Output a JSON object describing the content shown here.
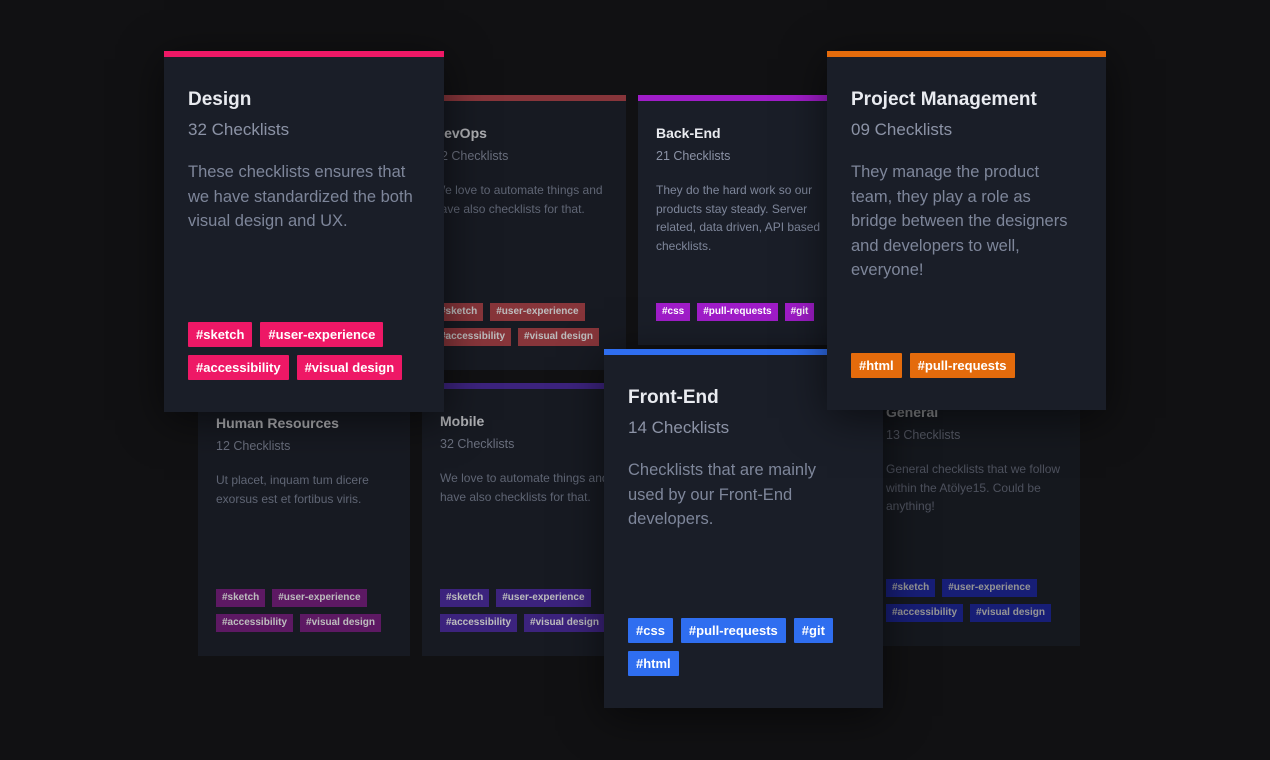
{
  "cards": {
    "devops": {
      "title": "DevOps",
      "count": "32 Checklists",
      "desc": "We love to automate things and have also checklists for that.",
      "tags": [
        "#sketch",
        "#user-experience",
        "#accessibility",
        "#visual design"
      ],
      "accent": "#b54349"
    },
    "backend": {
      "title": "Back-End",
      "count": "21 Checklists",
      "desc": "They do the hard work so our products stay steady. Server related, data driven, API based checklists.",
      "tags": [
        "#css",
        "#pull-requests",
        "#git"
      ],
      "accent": "#a01dc9"
    },
    "hr": {
      "title": "Human Resources",
      "count": "12 Checklists",
      "desc": "Ut placet, inquam tum dicere exorsus est et fortibus viris.",
      "tags": [
        "#sketch",
        "#user-experience",
        "#accessibility",
        "#visual design"
      ],
      "accent": "#7b1d82"
    },
    "mobile": {
      "title": "Mobile",
      "count": "32 Checklists",
      "desc": "We love to automate things and have also checklists for that.",
      "tags": [
        "#sketch",
        "#user-experience",
        "#accessibility",
        "#visual design"
      ],
      "accent": "#4d2aa7"
    },
    "general": {
      "title": "General",
      "count": "13 Checklists",
      "desc": "General checklists that we follow within the Atölye15. Could be anything!",
      "tags": [
        "#sketch",
        "#user-experience",
        "#accessibility",
        "#visual design"
      ],
      "accent": "#1c2ac8"
    },
    "design": {
      "title": "Design",
      "count": "32 Checklists",
      "desc": "These checklists ensures that we have standardized the both visual design and UX.",
      "tags": [
        "#sketch",
        "#user-experience",
        "#accessibility",
        "#visual design"
      ],
      "accent": "#ee1866"
    },
    "frontend": {
      "title": "Front-End",
      "count": "14 Checklists",
      "desc": "Checklists that are mainly used by our Front-End developers.",
      "tags": [
        "#css",
        "#pull-requests",
        "#git",
        "#html"
      ],
      "accent": "#2f6ef0"
    },
    "pm": {
      "title": "Project Management",
      "count": "09 Checklists",
      "desc": "They manage the product team, they play a role as bridge between the designers and developers to well, everyone!",
      "tags": [
        "#html",
        "#pull-requests"
      ],
      "accent": "#e46b0c"
    }
  }
}
